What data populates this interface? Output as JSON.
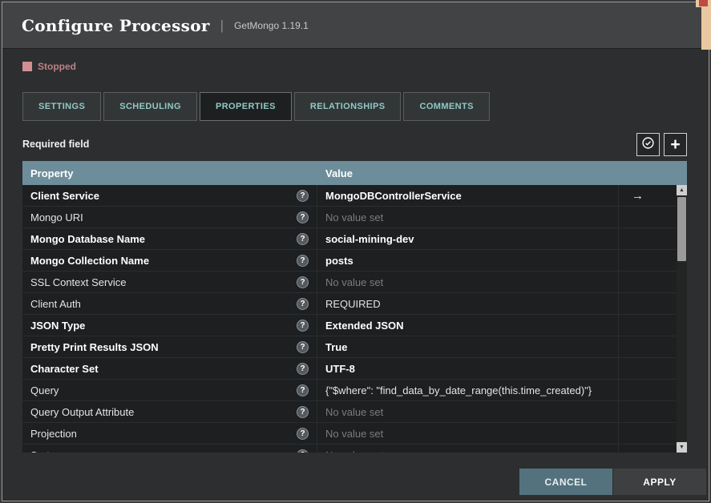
{
  "header": {
    "title": "Configure Processor",
    "separator": "|",
    "subtitle": "GetMongo 1.19.1"
  },
  "status": {
    "label": "Stopped",
    "color": "#d08f93"
  },
  "tabs": [
    {
      "id": "settings",
      "label": "SETTINGS",
      "active": false
    },
    {
      "id": "scheduling",
      "label": "SCHEDULING",
      "active": false
    },
    {
      "id": "properties",
      "label": "PROPERTIES",
      "active": true
    },
    {
      "id": "relationships",
      "label": "RELATIONSHIPS",
      "active": false
    },
    {
      "id": "comments",
      "label": "COMMENTS",
      "active": false
    }
  ],
  "toolbar": {
    "required_label": "Required field"
  },
  "icons": {
    "plus": "+",
    "help": "?",
    "arrow_right": "→",
    "scroll_up": "▲",
    "scroll_down": "▼"
  },
  "table": {
    "columns": [
      "Property",
      "Value",
      ""
    ],
    "rows": [
      {
        "property": "Client Service",
        "value": "MongoDBControllerService",
        "property_bold": true,
        "value_bold": true,
        "muted": false,
        "arrow": true
      },
      {
        "property": "Mongo URI",
        "value": "No value set",
        "property_bold": false,
        "value_bold": false,
        "muted": true,
        "arrow": false
      },
      {
        "property": "Mongo Database Name",
        "value": "social-mining-dev",
        "property_bold": true,
        "value_bold": true,
        "muted": false,
        "arrow": false
      },
      {
        "property": "Mongo Collection Name",
        "value": "posts",
        "property_bold": true,
        "value_bold": true,
        "muted": false,
        "arrow": false
      },
      {
        "property": "SSL Context Service",
        "value": "No value set",
        "property_bold": false,
        "value_bold": false,
        "muted": true,
        "arrow": false
      },
      {
        "property": "Client Auth",
        "value": "REQUIRED",
        "property_bold": false,
        "value_bold": false,
        "muted": false,
        "arrow": false
      },
      {
        "property": "JSON Type",
        "value": "Extended JSON",
        "property_bold": true,
        "value_bold": true,
        "muted": false,
        "arrow": false
      },
      {
        "property": "Pretty Print Results JSON",
        "value": "True",
        "property_bold": true,
        "value_bold": true,
        "muted": false,
        "arrow": false
      },
      {
        "property": "Character Set",
        "value": "UTF-8",
        "property_bold": true,
        "value_bold": true,
        "muted": false,
        "arrow": false
      },
      {
        "property": "Query",
        "value": "{\"$where\": \"find_data_by_date_range(this.time_created)\"}",
        "property_bold": false,
        "value_bold": false,
        "muted": false,
        "arrow": false
      },
      {
        "property": "Query Output Attribute",
        "value": "No value set",
        "property_bold": false,
        "value_bold": false,
        "muted": true,
        "arrow": false
      },
      {
        "property": "Projection",
        "value": "No value set",
        "property_bold": false,
        "value_bold": false,
        "muted": true,
        "arrow": false
      },
      {
        "property": "Sort",
        "value": "No value set",
        "property_bold": false,
        "value_bold": false,
        "muted": true,
        "arrow": false
      }
    ]
  },
  "footer": {
    "cancel_label": "CANCEL",
    "apply_label": "APPLY"
  },
  "colors": {
    "accent_teal": "#8fcac6",
    "table_header": "#6e8d9b",
    "status_pink": "#d08f93"
  }
}
